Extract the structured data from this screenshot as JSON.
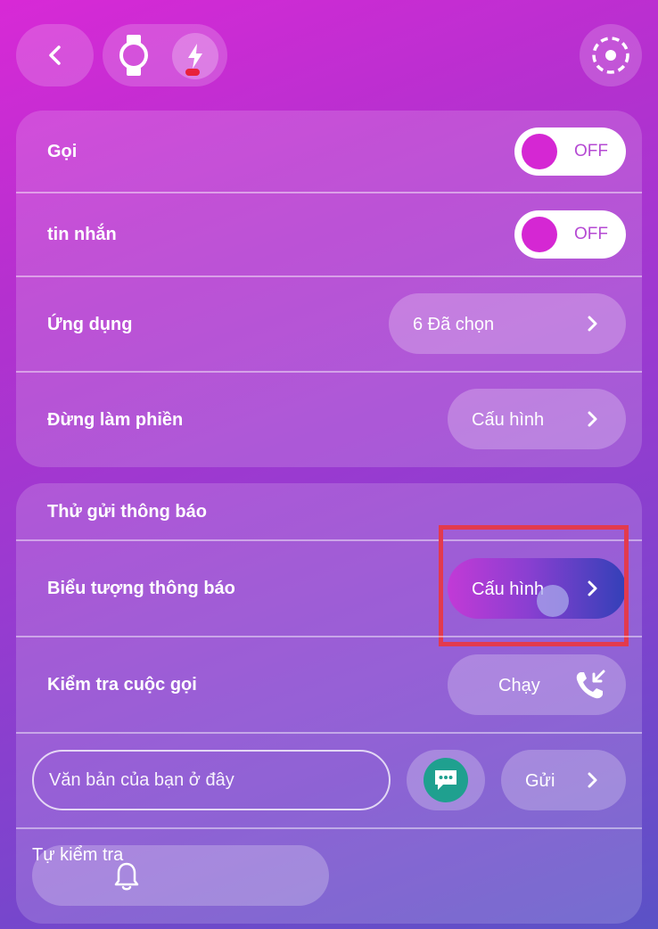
{
  "header": {
    "back_icon": "chevron-left-icon",
    "watch_icon": "watch-icon",
    "charge_icon": "lightning-icon",
    "settings_icon": "dashed-circle-icon"
  },
  "notifications": {
    "rows": [
      {
        "label": "Gọi",
        "toggle": "OFF"
      },
      {
        "label": "tin nhắn",
        "toggle": "OFF"
      },
      {
        "label": "Ứng dụng",
        "value": "6 Đã chọn"
      },
      {
        "label": "Đừng làm phiền",
        "value": "Cấu hình"
      }
    ]
  },
  "test": {
    "title": "Thử gửi thông báo",
    "icon_row": {
      "label": "Biểu tượng thông báo",
      "value": "Cấu hình"
    },
    "call_row": {
      "label": "Kiểm tra cuộc gọi",
      "value": "Chạy"
    },
    "message": {
      "placeholder": "Văn bản của bạn ở đây",
      "send": "Gửi"
    },
    "self_test": "Tự kiểm tra"
  },
  "colors": {
    "accent": "#d527d3",
    "highlight": "#e33a4d",
    "chat": "#1fa08f"
  }
}
